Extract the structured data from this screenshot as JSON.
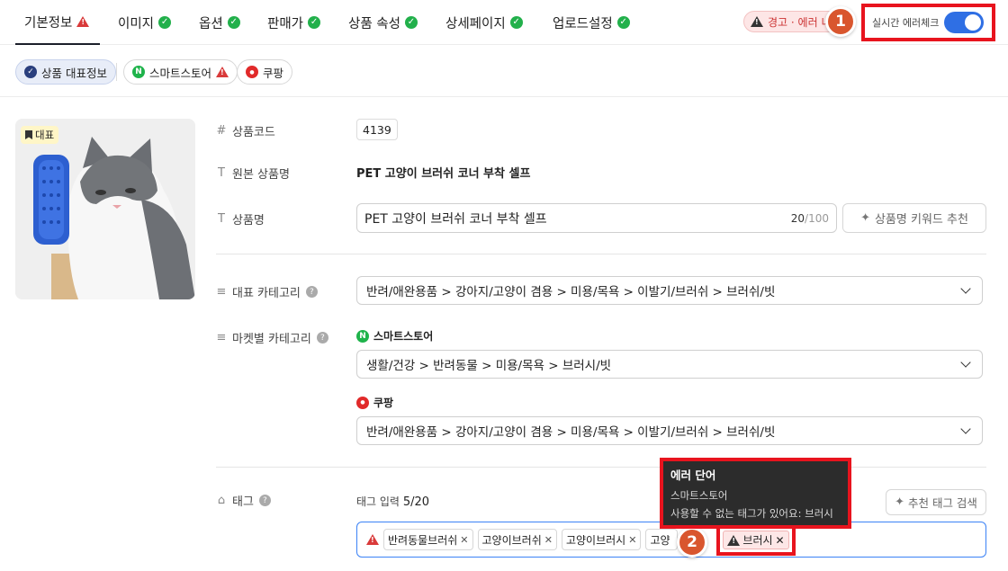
{
  "tabs": [
    {
      "label": "기본정보",
      "status": "warning"
    },
    {
      "label": "이미지",
      "status": "ok"
    },
    {
      "label": "옵션",
      "status": "ok"
    },
    {
      "label": "판매가",
      "status": "ok"
    },
    {
      "label": "상품 속성",
      "status": "ok"
    },
    {
      "label": "상세페이지",
      "status": "ok"
    },
    {
      "label": "업로드설정",
      "status": "ok"
    }
  ],
  "header": {
    "warning_pill": "경고 · 에러 니",
    "realtime_label": "실시간 에러체크",
    "realtime_on": true,
    "badge1": "1",
    "badge2": "2"
  },
  "market_tabs": [
    {
      "label": "상품 대표정보",
      "icon": "check-badge-icon",
      "active": true
    },
    {
      "label": "스마트스토어",
      "icon": "naver-icon",
      "status": "warning"
    },
    {
      "label": "쿠팡",
      "icon": "coupang-icon"
    }
  ],
  "image": {
    "rep_label": "대표"
  },
  "fields": {
    "code_label": "상품코드",
    "code_value": "4139",
    "orig_name_label": "원본 상품명",
    "orig_name_value": "PET 고양이 브러쉬 코너 부착 셀프",
    "name_label": "상품명",
    "name_value": "PET 고양이 브러쉬 코너 부착 셀프",
    "name_count": "20",
    "name_max": "/100",
    "keyword_button": "상품명 키워드 추천",
    "rep_category_label": "대표 카테고리",
    "rep_category_value": "반려/애완용품 > 강아지/고양이 겸용 > 미용/목욕 > 이발기/브러쉬 > 브러쉬/빗",
    "market_category_label": "마켓별 카테고리",
    "smartstore_label": "스마트스토어",
    "smartstore_category": "생활/건강 > 반려동물 > 미용/목욕 > 브러시/빗",
    "coupang_label": "쿠팡",
    "coupang_category": "반려/애완용품 > 강아지/고양이 겸용 > 미용/목욕 > 이발기/브러쉬 > 브러쉬/빗",
    "tag_label": "태그",
    "tag_input_label": "태그 입력",
    "tag_count": "5/20",
    "recommend_button": "추천 태그 검색"
  },
  "tags": [
    "반려동물브러쉬",
    "고양이브러쉬",
    "고양이브러시",
    "고양"
  ],
  "error_tag": "브러시",
  "tooltip": {
    "title": "에러 단어",
    "market": "스마트스토어",
    "message": "사용할 수 없는 태그가 있어요: 브러시"
  },
  "colors": {
    "accent": "#2f6fe4",
    "error": "#d93a3a",
    "ok": "#22b04b",
    "highlight": "#e8141e"
  }
}
